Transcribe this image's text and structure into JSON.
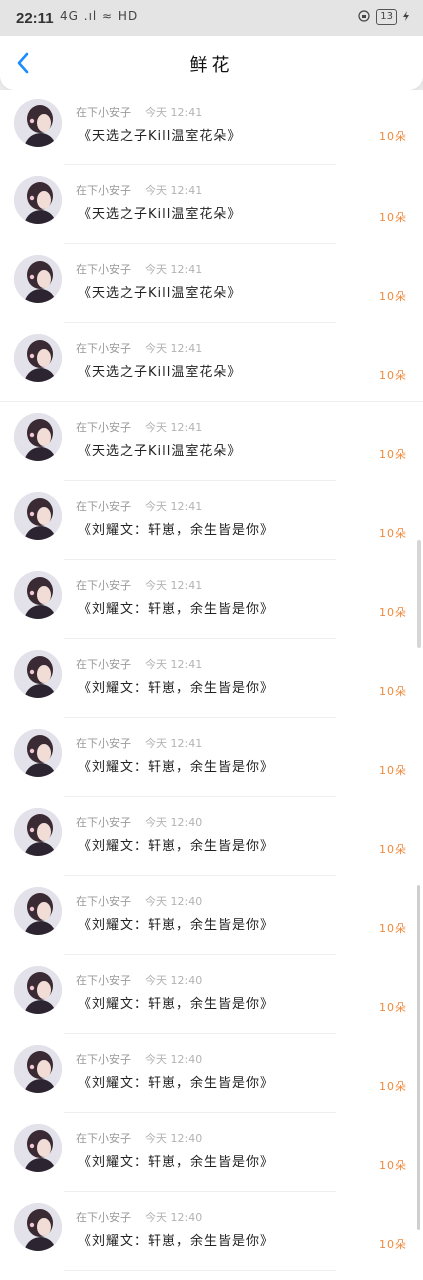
{
  "status_bar": {
    "time": "22:11",
    "left_icons": "4G .ıl ≈ HD",
    "battery": "13"
  },
  "header": {
    "back_icon": "chevron-left-icon",
    "title": "鲜花"
  },
  "colors": {
    "accent_back": "#1a8cff",
    "count_color": "#f08a3c"
  },
  "records": [
    {
      "user": "在下小安子",
      "time": "今天 12:41",
      "gift": "《天选之子Kill温室花朵》",
      "count": "10朵"
    },
    {
      "user": "在下小安子",
      "time": "今天 12:41",
      "gift": "《天选之子Kill温室花朵》",
      "count": "10朵"
    },
    {
      "user": "在下小安子",
      "time": "今天 12:41",
      "gift": "《天选之子Kill温室花朵》",
      "count": "10朵"
    },
    {
      "user": "在下小安子",
      "time": "今天 12:41",
      "gift": "《天选之子Kill温室花朵》",
      "count": "10朵"
    },
    {
      "user": "在下小安子",
      "time": "今天 12:41",
      "gift": "《天选之子Kill温室花朵》",
      "count": "10朵"
    },
    {
      "user": "在下小安子",
      "time": "今天 12:41",
      "gift": "《刘耀文：轩崽，余生皆是你》",
      "count": "10朵"
    },
    {
      "user": "在下小安子",
      "time": "今天 12:41",
      "gift": "《刘耀文：轩崽，余生皆是你》",
      "count": "10朵"
    },
    {
      "user": "在下小安子",
      "time": "今天 12:41",
      "gift": "《刘耀文：轩崽，余生皆是你》",
      "count": "10朵"
    },
    {
      "user": "在下小安子",
      "time": "今天 12:41",
      "gift": "《刘耀文：轩崽，余生皆是你》",
      "count": "10朵"
    },
    {
      "user": "在下小安子",
      "time": "今天 12:40",
      "gift": "《刘耀文：轩崽，余生皆是你》",
      "count": "10朵"
    },
    {
      "user": "在下小安子",
      "time": "今天 12:40",
      "gift": "《刘耀文：轩崽，余生皆是你》",
      "count": "10朵"
    },
    {
      "user": "在下小安子",
      "time": "今天 12:40",
      "gift": "《刘耀文：轩崽，余生皆是你》",
      "count": "10朵"
    },
    {
      "user": "在下小安子",
      "time": "今天 12:40",
      "gift": "《刘耀文：轩崽，余生皆是你》",
      "count": "10朵"
    },
    {
      "user": "在下小安子",
      "time": "今天 12:40",
      "gift": "《刘耀文：轩崽，余生皆是你》",
      "count": "10朵"
    },
    {
      "user": "在下小安子",
      "time": "今天 12:40",
      "gift": "《刘耀文：轩崽，余生皆是你》",
      "count": "10朵"
    }
  ]
}
